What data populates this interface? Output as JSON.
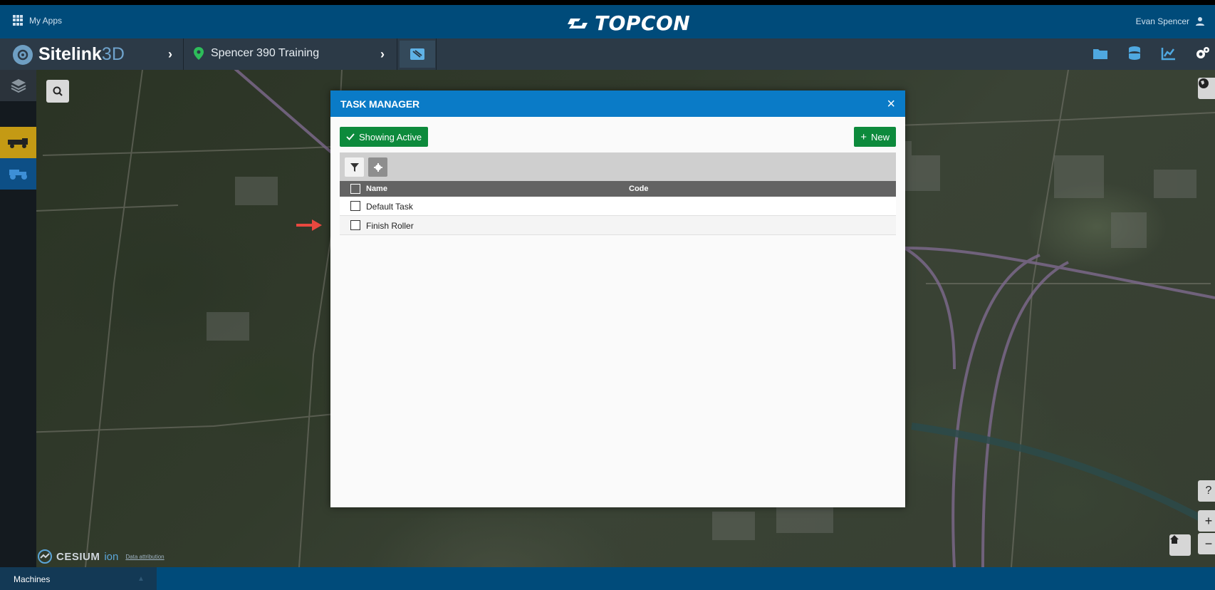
{
  "topbar": {
    "my_apps": "My Apps",
    "brand": "TOPCON",
    "user_name": "Evan Spencer"
  },
  "navbar": {
    "app_name_bold": "Sitelink",
    "app_name_light": "3D",
    "project_name": "Spencer 390 Training",
    "icons": [
      "folder-icon",
      "database-icon",
      "chart-icon",
      "settings-users-icon"
    ]
  },
  "map": {
    "attribution_brand": "CESIUM",
    "attribution_ion": "ion",
    "attribution_link": "Data attribution"
  },
  "bottombar": {
    "machines_label": "Machines"
  },
  "task_manager": {
    "title": "TASK MANAGER",
    "showing_active_label": "Showing Active",
    "new_label": "New",
    "columns": [
      "Name",
      "Code"
    ],
    "rows": [
      {
        "name": "Default Task",
        "code": ""
      },
      {
        "name": "Finish Roller",
        "code": ""
      }
    ]
  },
  "colors": {
    "topbar": "#004b7a",
    "navbar": "#2c3a47",
    "modal_header": "#0a7bc7",
    "green_button": "#0d8a3c",
    "annotation_arrow": "#e8483f"
  }
}
